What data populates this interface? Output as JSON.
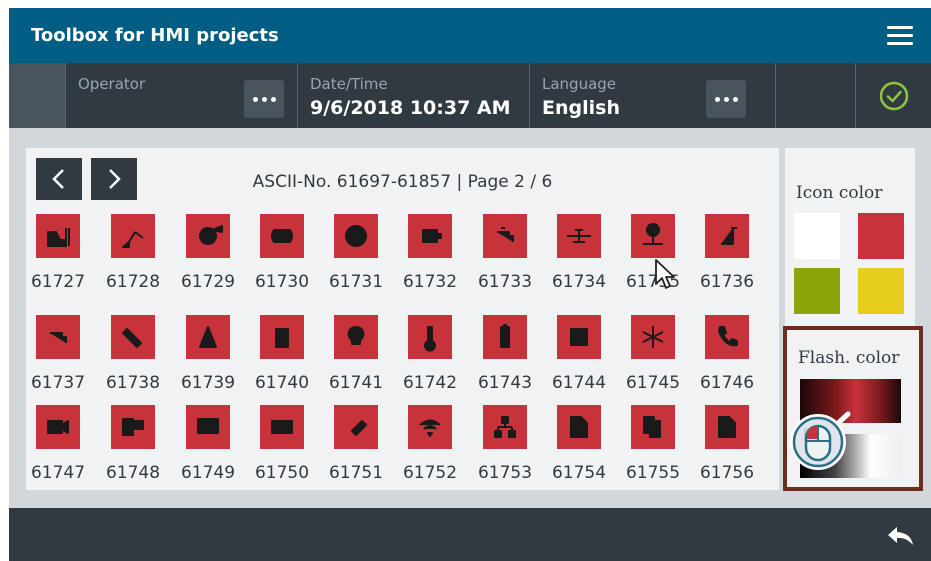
{
  "header": {
    "title": "Toolbox for HMI projects",
    "menu_icon": "hamburger-menu-icon"
  },
  "infobar": {
    "operator": {
      "label": "Operator",
      "value": ""
    },
    "datetime": {
      "label": "Date/Time",
      "value": "9/6/2018 10:37 AM"
    },
    "language": {
      "label": "Language",
      "value": "English"
    },
    "status_icon": "check-circle-icon"
  },
  "colors": {
    "titlebar": "#005d84",
    "infobar": "#323a41",
    "icon_red": "#c8323a",
    "status_green": "#8cc63f",
    "flash_border": "#6e2b1e"
  },
  "panel": {
    "page_info": "ASCII-No. 61697-61857 | Page 2 / 6",
    "prev_icon": "chevron-left-icon",
    "next_icon": "chevron-right-icon"
  },
  "icons": [
    {
      "number": "61727",
      "glyph": "forklift"
    },
    {
      "number": "61728",
      "glyph": "robot-arm"
    },
    {
      "number": "61729",
      "glyph": "pump"
    },
    {
      "number": "61730",
      "glyph": "tank"
    },
    {
      "number": "61731",
      "glyph": "fan"
    },
    {
      "number": "61732",
      "glyph": "motor"
    },
    {
      "number": "61733",
      "glyph": "faucet"
    },
    {
      "number": "61734",
      "glyph": "valve"
    },
    {
      "number": "61735",
      "glyph": "pressure-valve"
    },
    {
      "number": "61736",
      "glyph": "pipe"
    },
    {
      "number": "61737",
      "glyph": "tap"
    },
    {
      "number": "61738",
      "glyph": "test-tube"
    },
    {
      "number": "61739",
      "glyph": "cone"
    },
    {
      "number": "61740",
      "glyph": "tank-fill"
    },
    {
      "number": "61741",
      "glyph": "lightbulb"
    },
    {
      "number": "61742",
      "glyph": "thermometer"
    },
    {
      "number": "61743",
      "glyph": "battery"
    },
    {
      "number": "61744",
      "glyph": "radiator"
    },
    {
      "number": "61745",
      "glyph": "snowflake"
    },
    {
      "number": "61746",
      "glyph": "phone"
    },
    {
      "number": "61747",
      "glyph": "video-camera"
    },
    {
      "number": "61748",
      "glyph": "computer"
    },
    {
      "number": "61749",
      "glyph": "monitor"
    },
    {
      "number": "61750",
      "glyph": "plc"
    },
    {
      "number": "61751",
      "glyph": "usb-stick"
    },
    {
      "number": "61752",
      "glyph": "wifi"
    },
    {
      "number": "61753",
      "glyph": "network"
    },
    {
      "number": "61754",
      "glyph": "file-star"
    },
    {
      "number": "61755",
      "glyph": "files"
    },
    {
      "number": "61756",
      "glyph": "file-settings"
    }
  ],
  "labels_row_1": [
    "61727",
    "61728",
    "61729",
    "61730",
    "61731",
    "61732",
    "61733",
    "61734",
    "61735",
    "61736"
  ],
  "labels_row_2": [
    "61737",
    "61738",
    "61739",
    "61740",
    "61741",
    "61742",
    "61743",
    "61744",
    "61745",
    "61746"
  ],
  "labels_row_3": [
    "61747",
    "61748",
    "61749",
    "61750",
    "61751",
    "61752",
    "61753",
    "61754",
    "61755",
    "61756"
  ],
  "right_panel": {
    "icon_color_label": "Icon color",
    "flash_color_label": "Flash. color",
    "swatches": [
      {
        "name": "white",
        "color": "#ffffff"
      },
      {
        "name": "red",
        "color": "#c8323a"
      },
      {
        "name": "green",
        "color": "#8ca50a"
      },
      {
        "name": "yellow",
        "color": "#e6cd1e"
      }
    ]
  },
  "footer": {
    "back_icon": "back-arrow-icon"
  }
}
